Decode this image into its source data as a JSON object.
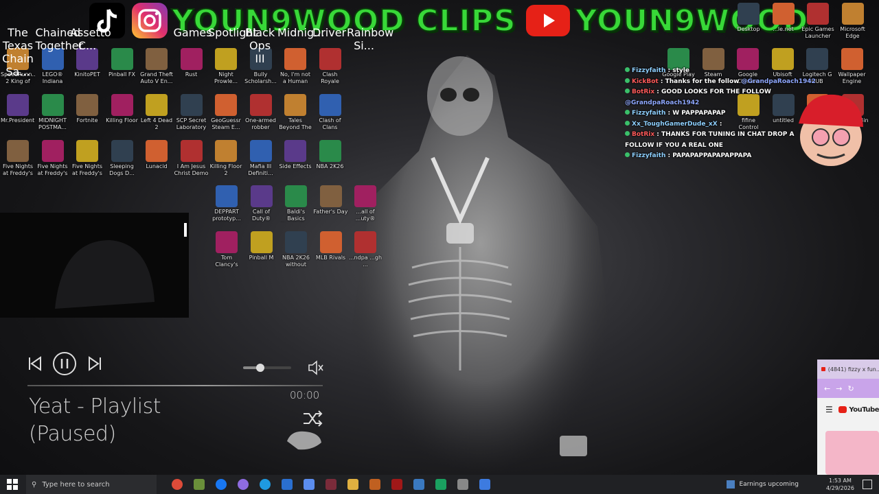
{
  "banner": {
    "clips_title": "YOUN9WOOD CLIPS",
    "youtube_name": "YOUN9WOOD"
  },
  "desktop_icons": {
    "row0": [
      "The Texas Chain Sa...",
      "Chained Together",
      "Assetto C...",
      "Games",
      "Spotlight",
      "Black Ops III",
      "Midnig...",
      "Driver",
      "Rainbow Si..."
    ],
    "row1": [
      "SpeedRunn... 2 King of S...",
      "LEGO® Indiana Jon...",
      "KinitoPET",
      "Pinball FX",
      "Grand Theft Auto V En...",
      "Rust",
      "Night Prowle...",
      "Bully Scholarsh...",
      "No, I'm not a Human",
      "Clash Royale"
    ],
    "row2": [
      "Mr.President!",
      "MIDNIGHT POSTMA...",
      "Fortnite",
      "Killing Floor",
      "Left 4 Dead 2",
      "SCP Secret Laboratory",
      "GeoGuessr Steam E...",
      "One-armed robber",
      "Tales Beyond The Tomb ...",
      "Clash of Clans"
    ],
    "row3": [
      "Five Nights at Freddy's",
      "Five Nights at Freddy's 2",
      "Five Nights at Freddy's 3",
      "Sleeping Dogs D...",
      "Lunacid",
      "I Am Jesus Christ Demo",
      "Killing Floor 2",
      "Mafia III Definiti...",
      "Side Effects",
      "NBA 2K26"
    ],
    "row4": [
      "DEPPART prototyp...",
      "Call of Duty®",
      "Baldi's Basics Classic Re...",
      "Father's Day",
      "...all of ...uty®"
    ],
    "row5": [
      "Tom Clancy's Rainbow Si...",
      "Pinball M",
      "NBA 2K26 without EA...",
      "MLB Rivals",
      "...ndpa ...gh ..."
    ],
    "right_top": [
      "Desktop",
      "...le.net",
      "Epic Games Launcher",
      "Microsoft Edge"
    ],
    "right_row1": [
      "Google Play",
      "Steam",
      "Google Chrome",
      "Ubisoft",
      "Logitech G HUB",
      "Wallpaper Engine"
    ],
    "right_row2": [
      "fifine Control Deck.exe",
      "untitled",
      "...wa...",
      "Recycle Bin"
    ]
  },
  "chat": [
    {
      "user": "Fizzyfaith",
      "color": "#8fd0ff",
      "msg": " : style"
    },
    {
      "user": "KickBot",
      "color": "#ff5a5a",
      "msg": " : Thanks for the follow ",
      "mention": "@GrandpaRoach1942"
    },
    {
      "user": "BotRix",
      "color": "#ff5a5a",
      "msg": " : GOOD LOOKS FOR THE FOLLOW ",
      "mention": "@GrandpaRoach1942"
    },
    {
      "user": "Fizzyfaith",
      "color": "#8fd0ff",
      "msg": " : W PAPPAPAPAP"
    },
    {
      "user": "Xx_ToughGamerDude_xX",
      "color": "#8fd0ff",
      "msg": " : "
    },
    {
      "user": "BotRix",
      "color": "#ff5a5a",
      "msg": " : THANKS FOR TUNING IN CHAT DROP A FOLLOW IF YOU A REAL ONE"
    },
    {
      "user": "Fizzyfaith",
      "color": "#8fd0ff",
      "msg": " : PAPAPAPPAPAPAPPAPA"
    }
  ],
  "player": {
    "track": "Yeat - Playlist",
    "state": "(Paused)",
    "time": "00:00",
    "volume_level": 0.35
  },
  "browser": {
    "tab_title": "(4841) fizzy x fun...",
    "brand": "YouTube"
  },
  "taskbar": {
    "search_placeholder": "Type here to search",
    "news": "Earnings upcoming",
    "time": "1:53 AM",
    "date": "4/29/2026"
  }
}
